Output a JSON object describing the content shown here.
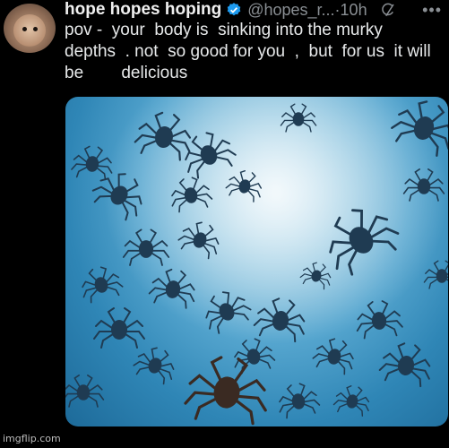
{
  "tweet": {
    "display_name": "hope hopes hoping",
    "handle": "@hopes_r...",
    "time": "·10h",
    "more_label": "•••",
    "text": "pov -  your  body is  sinking into the murky\ndepths  . not  so good for you  ,  but  for us  it will\nbe        delicious",
    "verified_color": "#1d9bf0"
  },
  "media": {
    "icon": "crabs-underwater-photo"
  },
  "watermark": "imgflip.com"
}
